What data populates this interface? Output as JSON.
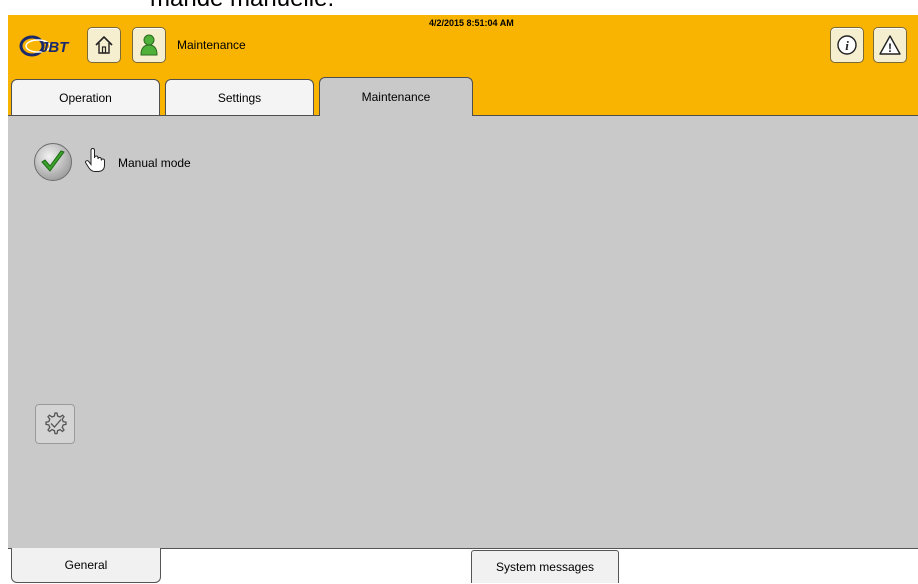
{
  "document": {
    "caption_fragment": "mande manuelle."
  },
  "header": {
    "logo_text": "JBT",
    "screen_title": "Maintenance",
    "datetime": "4/2/2015 8:51:04 AM",
    "accent_color": "#f8b400",
    "icons": [
      "home-icon",
      "user-icon",
      "info-icon",
      "warning-icon"
    ]
  },
  "tabs": [
    {
      "label": "Operation",
      "active": false
    },
    {
      "label": "Settings",
      "active": false
    },
    {
      "label": "Maintenance",
      "active": true
    }
  ],
  "main": {
    "manual_mode": {
      "label": "Manual mode",
      "checked": true,
      "check_color": "#3aa12a"
    }
  },
  "bottom_tabs": [
    {
      "label": "General",
      "active": true
    },
    {
      "label": "System messages",
      "active": false
    }
  ]
}
